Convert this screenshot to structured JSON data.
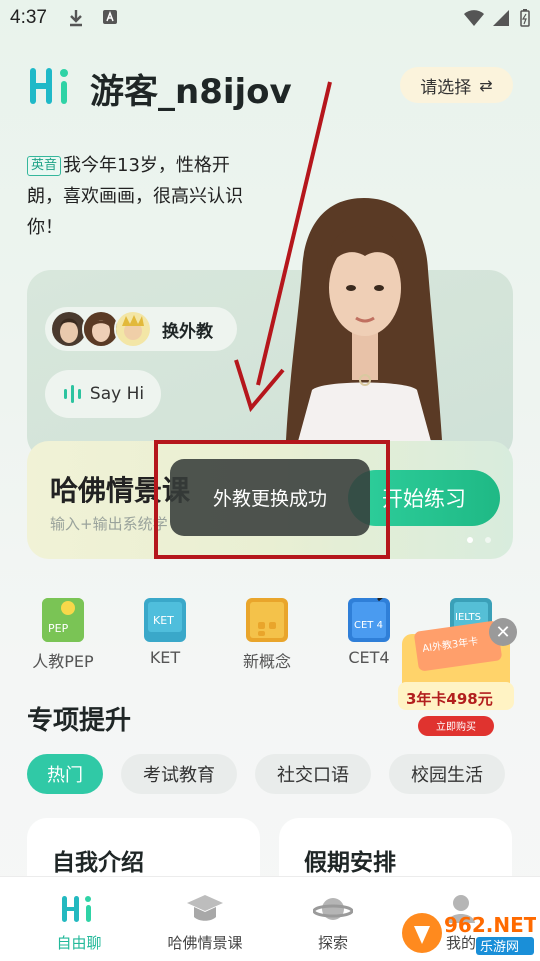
{
  "status_bar": {
    "time": "4:37"
  },
  "header": {
    "user_name": "游客_n8ijov",
    "select_label": "请选择",
    "select_icon": "swap-icon"
  },
  "intro": {
    "badge": "英音",
    "text": "我今年13岁，性格开朗，喜欢画画，很高兴认识你！"
  },
  "teacher_card": {
    "switch_label": "换外教",
    "say_hi_label": "Say Hi"
  },
  "banner": {
    "title": "哈佛情景课",
    "subtitle": "输入+输出系统学",
    "button_label": "开始练习",
    "page_indicator": {
      "current": 1,
      "total": 2
    }
  },
  "toast": {
    "message": "外教更换成功"
  },
  "courses": [
    {
      "label": "人教PEP",
      "icon_text": "PEP"
    },
    {
      "label": "KET",
      "icon_text": "KET"
    },
    {
      "label": "新概念",
      "icon_text": ""
    },
    {
      "label": "CET4",
      "icon_text": "CET 4"
    },
    {
      "label": "",
      "icon_text": "IELTS"
    }
  ],
  "promo": {
    "top_text": "AI外教3年卡",
    "price_text": "3年卡498元",
    "button_label": "立即购买"
  },
  "section": {
    "title": "专项提升",
    "chips": [
      "热门",
      "考试教育",
      "社交口语",
      "校园生活"
    ],
    "active_chip": 0,
    "cards": [
      "自我介绍",
      "假期安排"
    ]
  },
  "bottom_nav": {
    "items": [
      {
        "label": "自由聊",
        "icon": "hi-icon"
      },
      {
        "label": "哈佛情景课",
        "icon": "graduation-cap-icon"
      },
      {
        "label": "探索",
        "icon": "planet-icon"
      },
      {
        "label": "我的",
        "icon": "profile-icon"
      }
    ],
    "active": 0
  },
  "watermark": {
    "brand": "962.NET",
    "sub": "乐游网"
  },
  "colors": {
    "accent": "#30c9a6",
    "annotation_red": "#b5161c",
    "pill_yellow": "#fbf3dc"
  }
}
